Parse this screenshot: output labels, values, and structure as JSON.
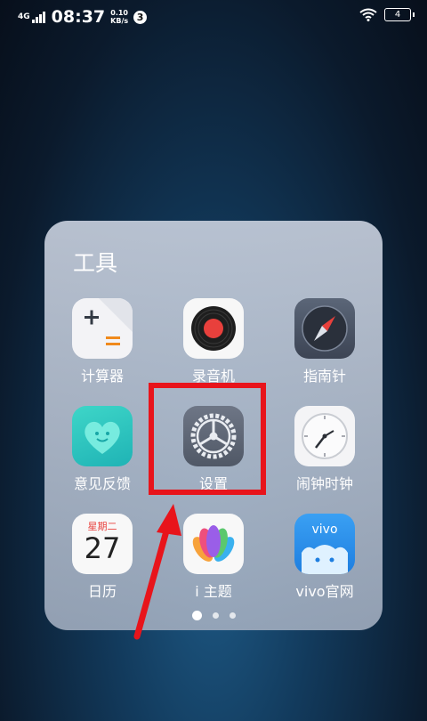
{
  "status_bar": {
    "network": "4G",
    "time": "08:37",
    "speed_value": "0.10",
    "speed_unit": "KB/s",
    "notification_count": "3",
    "battery": "4"
  },
  "folder": {
    "title": "工具",
    "apps": [
      {
        "label": "计算器",
        "icon": "calculator-icon"
      },
      {
        "label": "录音机",
        "icon": "recorder-icon"
      },
      {
        "label": "指南针",
        "icon": "compass-icon"
      },
      {
        "label": "意见反馈",
        "icon": "feedback-heart-icon"
      },
      {
        "label": "设置",
        "icon": "settings-gear-icon"
      },
      {
        "label": "闹钟时钟",
        "icon": "clock-icon"
      },
      {
        "label": "日历",
        "icon": "calendar-icon",
        "weekday": "星期二",
        "day": "27"
      },
      {
        "label": "i 主题",
        "icon": "theme-lotus-icon"
      },
      {
        "label": "vivo官网",
        "icon": "vivo-store-icon",
        "brand": "vivo"
      }
    ],
    "pages": 3,
    "current_page": 1
  },
  "annotation": {
    "highlight_color": "#e8141b"
  }
}
